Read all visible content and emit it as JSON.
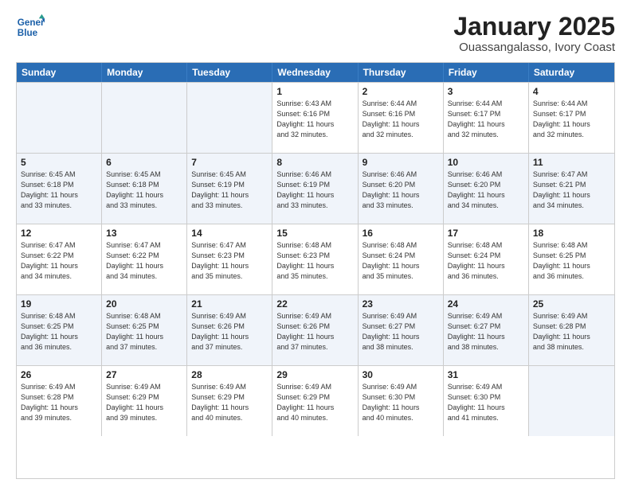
{
  "header": {
    "logo_line1": "General",
    "logo_line2": "Blue",
    "title": "January 2025",
    "subtitle": "Ouassangalasso, Ivory Coast"
  },
  "weekdays": [
    "Sunday",
    "Monday",
    "Tuesday",
    "Wednesday",
    "Thursday",
    "Friday",
    "Saturday"
  ],
  "weeks": [
    [
      {
        "day": "",
        "info": ""
      },
      {
        "day": "",
        "info": ""
      },
      {
        "day": "",
        "info": ""
      },
      {
        "day": "1",
        "info": "Sunrise: 6:43 AM\nSunset: 6:16 PM\nDaylight: 11 hours\nand 32 minutes."
      },
      {
        "day": "2",
        "info": "Sunrise: 6:44 AM\nSunset: 6:16 PM\nDaylight: 11 hours\nand 32 minutes."
      },
      {
        "day": "3",
        "info": "Sunrise: 6:44 AM\nSunset: 6:17 PM\nDaylight: 11 hours\nand 32 minutes."
      },
      {
        "day": "4",
        "info": "Sunrise: 6:44 AM\nSunset: 6:17 PM\nDaylight: 11 hours\nand 32 minutes."
      }
    ],
    [
      {
        "day": "5",
        "info": "Sunrise: 6:45 AM\nSunset: 6:18 PM\nDaylight: 11 hours\nand 33 minutes."
      },
      {
        "day": "6",
        "info": "Sunrise: 6:45 AM\nSunset: 6:18 PM\nDaylight: 11 hours\nand 33 minutes."
      },
      {
        "day": "7",
        "info": "Sunrise: 6:45 AM\nSunset: 6:19 PM\nDaylight: 11 hours\nand 33 minutes."
      },
      {
        "day": "8",
        "info": "Sunrise: 6:46 AM\nSunset: 6:19 PM\nDaylight: 11 hours\nand 33 minutes."
      },
      {
        "day": "9",
        "info": "Sunrise: 6:46 AM\nSunset: 6:20 PM\nDaylight: 11 hours\nand 33 minutes."
      },
      {
        "day": "10",
        "info": "Sunrise: 6:46 AM\nSunset: 6:20 PM\nDaylight: 11 hours\nand 34 minutes."
      },
      {
        "day": "11",
        "info": "Sunrise: 6:47 AM\nSunset: 6:21 PM\nDaylight: 11 hours\nand 34 minutes."
      }
    ],
    [
      {
        "day": "12",
        "info": "Sunrise: 6:47 AM\nSunset: 6:22 PM\nDaylight: 11 hours\nand 34 minutes."
      },
      {
        "day": "13",
        "info": "Sunrise: 6:47 AM\nSunset: 6:22 PM\nDaylight: 11 hours\nand 34 minutes."
      },
      {
        "day": "14",
        "info": "Sunrise: 6:47 AM\nSunset: 6:23 PM\nDaylight: 11 hours\nand 35 minutes."
      },
      {
        "day": "15",
        "info": "Sunrise: 6:48 AM\nSunset: 6:23 PM\nDaylight: 11 hours\nand 35 minutes."
      },
      {
        "day": "16",
        "info": "Sunrise: 6:48 AM\nSunset: 6:24 PM\nDaylight: 11 hours\nand 35 minutes."
      },
      {
        "day": "17",
        "info": "Sunrise: 6:48 AM\nSunset: 6:24 PM\nDaylight: 11 hours\nand 36 minutes."
      },
      {
        "day": "18",
        "info": "Sunrise: 6:48 AM\nSunset: 6:25 PM\nDaylight: 11 hours\nand 36 minutes."
      }
    ],
    [
      {
        "day": "19",
        "info": "Sunrise: 6:48 AM\nSunset: 6:25 PM\nDaylight: 11 hours\nand 36 minutes."
      },
      {
        "day": "20",
        "info": "Sunrise: 6:48 AM\nSunset: 6:25 PM\nDaylight: 11 hours\nand 37 minutes."
      },
      {
        "day": "21",
        "info": "Sunrise: 6:49 AM\nSunset: 6:26 PM\nDaylight: 11 hours\nand 37 minutes."
      },
      {
        "day": "22",
        "info": "Sunrise: 6:49 AM\nSunset: 6:26 PM\nDaylight: 11 hours\nand 37 minutes."
      },
      {
        "day": "23",
        "info": "Sunrise: 6:49 AM\nSunset: 6:27 PM\nDaylight: 11 hours\nand 38 minutes."
      },
      {
        "day": "24",
        "info": "Sunrise: 6:49 AM\nSunset: 6:27 PM\nDaylight: 11 hours\nand 38 minutes."
      },
      {
        "day": "25",
        "info": "Sunrise: 6:49 AM\nSunset: 6:28 PM\nDaylight: 11 hours\nand 38 minutes."
      }
    ],
    [
      {
        "day": "26",
        "info": "Sunrise: 6:49 AM\nSunset: 6:28 PM\nDaylight: 11 hours\nand 39 minutes."
      },
      {
        "day": "27",
        "info": "Sunrise: 6:49 AM\nSunset: 6:29 PM\nDaylight: 11 hours\nand 39 minutes."
      },
      {
        "day": "28",
        "info": "Sunrise: 6:49 AM\nSunset: 6:29 PM\nDaylight: 11 hours\nand 40 minutes."
      },
      {
        "day": "29",
        "info": "Sunrise: 6:49 AM\nSunset: 6:29 PM\nDaylight: 11 hours\nand 40 minutes."
      },
      {
        "day": "30",
        "info": "Sunrise: 6:49 AM\nSunset: 6:30 PM\nDaylight: 11 hours\nand 40 minutes."
      },
      {
        "day": "31",
        "info": "Sunrise: 6:49 AM\nSunset: 6:30 PM\nDaylight: 11 hours\nand 41 minutes."
      },
      {
        "day": "",
        "info": ""
      }
    ]
  ]
}
